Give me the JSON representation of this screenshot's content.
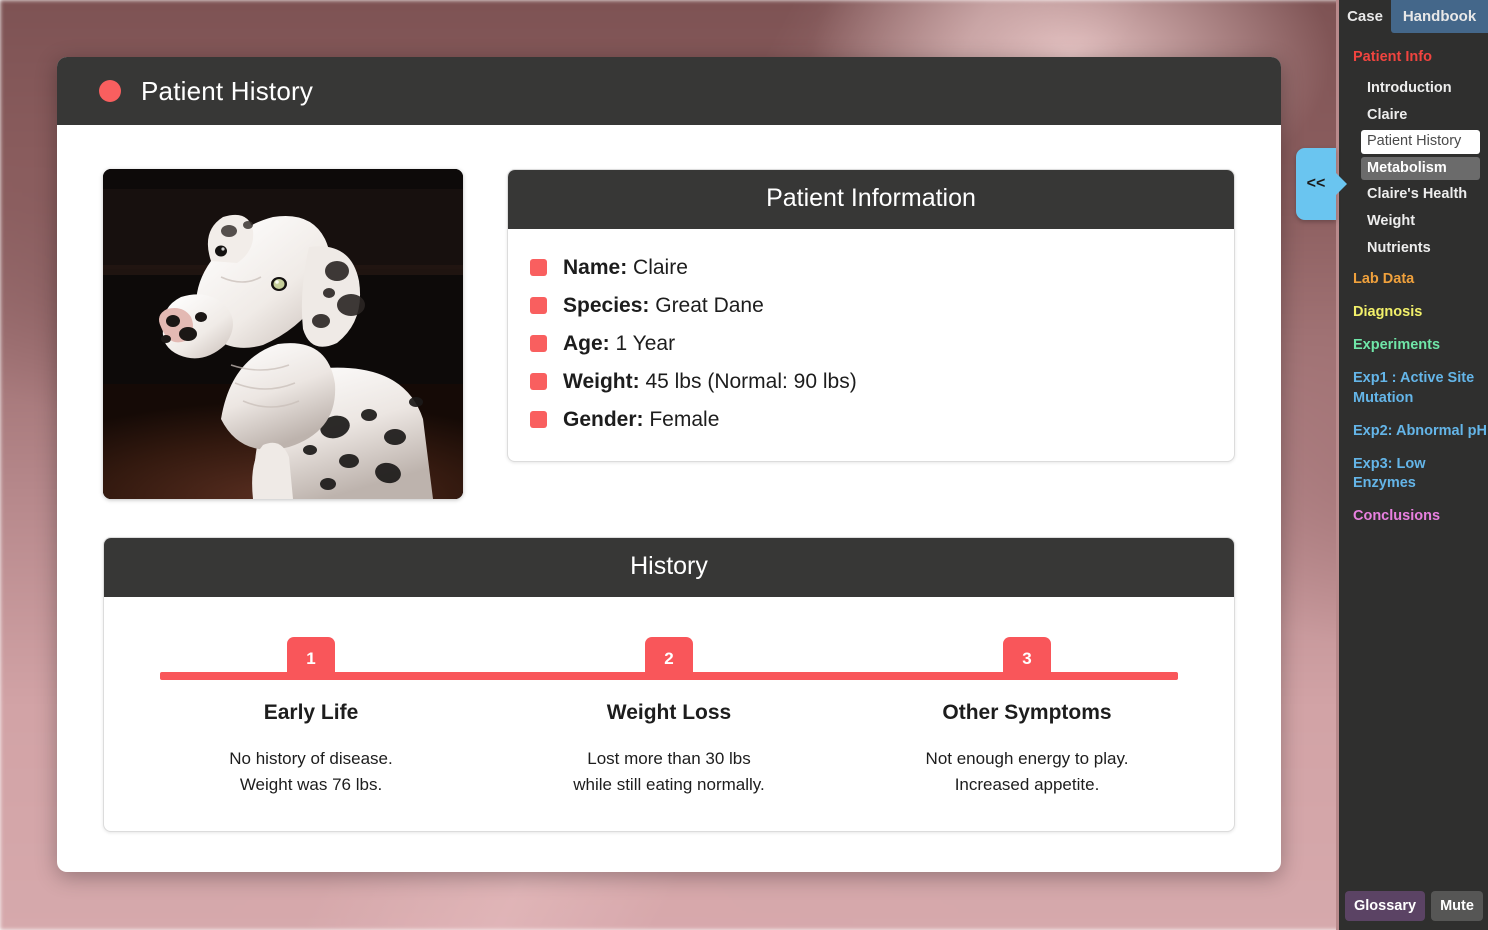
{
  "background": {
    "description": "blurred-pink-photo"
  },
  "card": {
    "title": "Patient History",
    "status_dot_color": "#f95f5f"
  },
  "photo": {
    "alt": "Great Dane dog named Claire sitting in dim room"
  },
  "patient_information": {
    "heading": "Patient Information",
    "items": [
      {
        "label": "Name:",
        "value": "Claire"
      },
      {
        "label": "Species:",
        "value": "Great Dane"
      },
      {
        "label": "Age:",
        "value": "1 Year"
      },
      {
        "label": "Weight:",
        "value": "45 lbs (Normal: 90 lbs)"
      },
      {
        "label": "Gender:",
        "value": "Female"
      }
    ]
  },
  "history": {
    "heading": "History",
    "events": [
      {
        "number": "1",
        "title": "Early Life",
        "line1": "No history of disease.",
        "line2": "Weight was 76 lbs."
      },
      {
        "number": "2",
        "title": "Weight Loss",
        "line1": "Lost more than 30 lbs",
        "line2": "while still eating normally."
      },
      {
        "number": "3",
        "title": "Other Symptoms",
        "line1": "Not enough energy to play.",
        "line2": "Increased appetite."
      }
    ]
  },
  "sidebar": {
    "tabs": [
      {
        "label": "Case",
        "active": false
      },
      {
        "label": "Handbook",
        "active": true
      }
    ],
    "nav": [
      {
        "label": "Patient Info",
        "type": "section",
        "color": "#f0443f"
      },
      {
        "label": "Introduction",
        "type": "sub",
        "state": "normal"
      },
      {
        "label": "Claire",
        "type": "sub",
        "state": "normal"
      },
      {
        "label": "Patient History",
        "type": "sub",
        "state": "current"
      },
      {
        "label": "Metabolism",
        "type": "sub",
        "state": "hover"
      },
      {
        "label": "Claire's Health",
        "type": "sub",
        "state": "normal"
      },
      {
        "label": "Weight",
        "type": "sub",
        "state": "normal"
      },
      {
        "label": "Nutrients",
        "type": "sub",
        "state": "normal"
      },
      {
        "label": "Lab Data",
        "type": "section",
        "color": "#f0a13c"
      },
      {
        "label": "Diagnosis",
        "type": "section",
        "color": "#f2f06a"
      },
      {
        "label": "Experiments",
        "type": "section",
        "color": "#6fe6a8"
      },
      {
        "label": "Exp1 : Active Site Mutation",
        "type": "section",
        "color": "#64b5e8"
      },
      {
        "label": "Exp2: Abnormal pH",
        "type": "section",
        "color": "#64b5e8"
      },
      {
        "label": "Exp3: Low Enzymes",
        "type": "section",
        "color": "#64b5e8"
      },
      {
        "label": "Conclusions",
        "type": "section",
        "color": "#e880e0"
      }
    ],
    "collapse_label": "<<",
    "glossary_label": "Glossary",
    "mute_label": "Mute"
  }
}
